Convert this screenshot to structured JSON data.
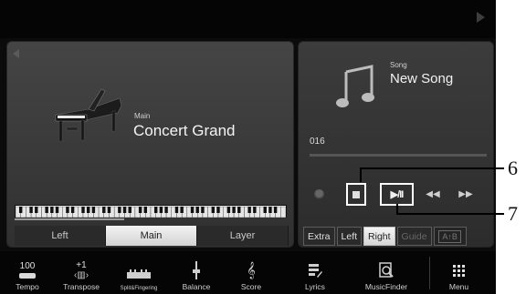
{
  "main_voice": {
    "caption": "Main",
    "name": "Concert Grand"
  },
  "part_tabs": [
    {
      "label": "Left",
      "selected": false
    },
    {
      "label": "Main",
      "selected": true
    },
    {
      "label": "Layer",
      "selected": false
    }
  ],
  "song": {
    "caption": "Song",
    "name": "New Song",
    "position": "016",
    "progress": 0
  },
  "transport": {
    "play_pause_label": "▶/II",
    "rewind_label": "◀◀",
    "fast_forward_label": "▶▶"
  },
  "score_tabs": [
    {
      "label": "Extra",
      "selected": false
    },
    {
      "label": "Left",
      "selected": false
    },
    {
      "label": "Right",
      "selected": true
    },
    {
      "label": "Guide",
      "selected": false
    }
  ],
  "ab_repeat_label": "A↑B",
  "menu": {
    "tempo": {
      "value": "100",
      "label": "Tempo"
    },
    "transpose": {
      "value": "+1",
      "label": "Transpose"
    },
    "split": {
      "label": "Split&Fingering"
    },
    "balance": {
      "label": "Balance"
    },
    "score": {
      "label": "Score"
    },
    "lyrics": {
      "label": "Lyrics"
    },
    "musicfinder": {
      "label": "MusicFinder"
    },
    "menu": {
      "label": "Menu"
    }
  },
  "callouts": {
    "stop": "6",
    "play": "7"
  },
  "colors": {
    "screen_bg": "#0b0b0b",
    "panel_bg": "#3a3a3a",
    "selected_tab": "#e8e8e8"
  }
}
